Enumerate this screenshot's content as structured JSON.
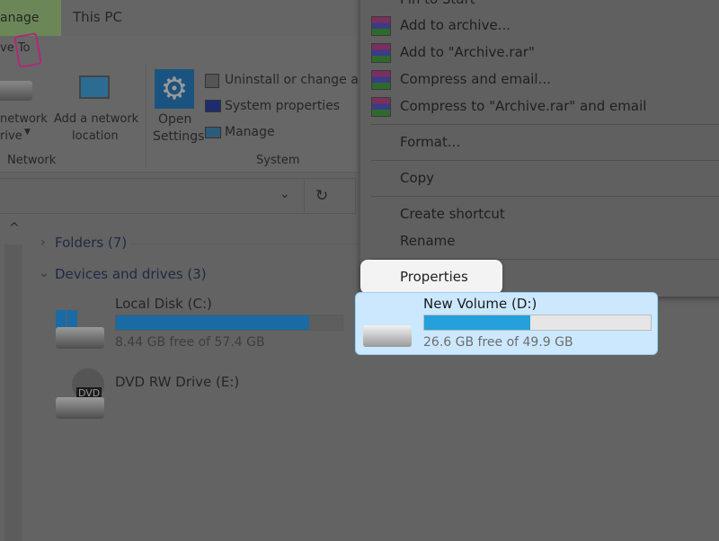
{
  "window": {
    "title": "This PC",
    "context_tab": "anage",
    "drive_tools_tab": "ve To"
  },
  "ribbon": {
    "network_group": {
      "label": "Network",
      "map_drive": [
        "network",
        "rive"
      ],
      "add_location": [
        "Add a network",
        "location"
      ]
    },
    "system_group": {
      "label": "System",
      "open_settings": [
        "Open",
        "Settings"
      ],
      "items": [
        "Uninstall or change a pr",
        "System properties",
        "Manage"
      ]
    }
  },
  "context_menu": {
    "items": [
      {
        "label": "Pin to Start",
        "icon": "none"
      },
      {
        "label": "Add to archive...",
        "icon": "winrar-icon"
      },
      {
        "label": "Add to \"Archive.rar\"",
        "icon": "winrar-icon"
      },
      {
        "label": "Compress and email...",
        "icon": "winrar-icon"
      },
      {
        "label": "Compress to \"Archive.rar\" and email",
        "icon": "winrar-icon"
      },
      {
        "label": "Format..."
      },
      {
        "label": "Copy"
      },
      {
        "label": "Create shortcut"
      },
      {
        "label": "Rename"
      },
      {
        "label": "Properties",
        "highlighted": true
      }
    ]
  },
  "content": {
    "folders_header": "Folders (7)",
    "devices_header": "Devices and drives (3)",
    "drives": [
      {
        "name": "Local Disk (C:)",
        "info": "8.44 GB free of 57.4 GB",
        "used_percent": 85.3,
        "bar_color": "#1a6ba3"
      },
      {
        "name": "New Volume (D:)",
        "info": "26.6 GB free of 49.9 GB",
        "used_percent": 46.7,
        "bar_color": "#26a0da",
        "selected": true
      },
      {
        "name": "DVD RW Drive (E:)",
        "badge": "DVD"
      }
    ]
  },
  "colors": {
    "selection": "#cce8ff",
    "manage_tab": "#6b8757"
  }
}
